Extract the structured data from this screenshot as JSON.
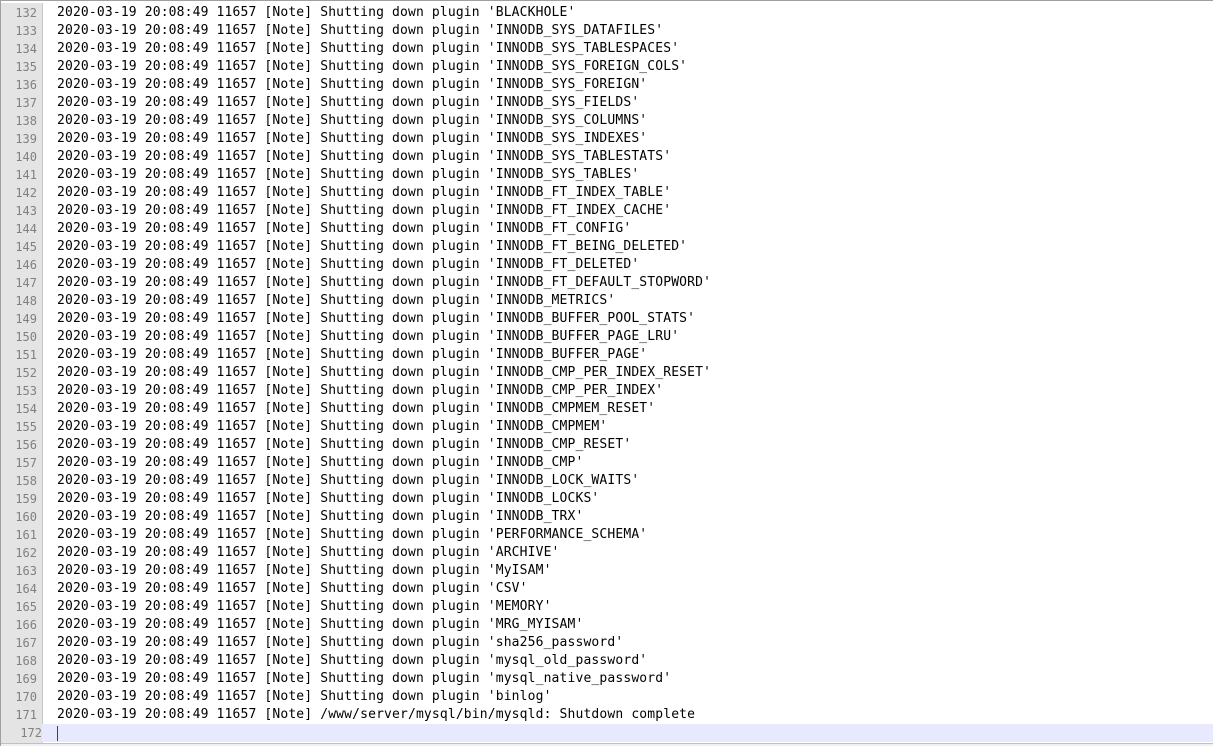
{
  "editor": {
    "current_line": 172,
    "lines": [
      {
        "num": "132",
        "text": "2020-03-19 20:08:49 11657 [Note] Shutting down plugin 'BLACKHOLE'"
      },
      {
        "num": "133",
        "text": "2020-03-19 20:08:49 11657 [Note] Shutting down plugin 'INNODB_SYS_DATAFILES'"
      },
      {
        "num": "134",
        "text": "2020-03-19 20:08:49 11657 [Note] Shutting down plugin 'INNODB_SYS_TABLESPACES'"
      },
      {
        "num": "135",
        "text": "2020-03-19 20:08:49 11657 [Note] Shutting down plugin 'INNODB_SYS_FOREIGN_COLS'"
      },
      {
        "num": "136",
        "text": "2020-03-19 20:08:49 11657 [Note] Shutting down plugin 'INNODB_SYS_FOREIGN'"
      },
      {
        "num": "137",
        "text": "2020-03-19 20:08:49 11657 [Note] Shutting down plugin 'INNODB_SYS_FIELDS'"
      },
      {
        "num": "138",
        "text": "2020-03-19 20:08:49 11657 [Note] Shutting down plugin 'INNODB_SYS_COLUMNS'"
      },
      {
        "num": "139",
        "text": "2020-03-19 20:08:49 11657 [Note] Shutting down plugin 'INNODB_SYS_INDEXES'"
      },
      {
        "num": "140",
        "text": "2020-03-19 20:08:49 11657 [Note] Shutting down plugin 'INNODB_SYS_TABLESTATS'"
      },
      {
        "num": "141",
        "text": "2020-03-19 20:08:49 11657 [Note] Shutting down plugin 'INNODB_SYS_TABLES'"
      },
      {
        "num": "142",
        "text": "2020-03-19 20:08:49 11657 [Note] Shutting down plugin 'INNODB_FT_INDEX_TABLE'"
      },
      {
        "num": "143",
        "text": "2020-03-19 20:08:49 11657 [Note] Shutting down plugin 'INNODB_FT_INDEX_CACHE'"
      },
      {
        "num": "144",
        "text": "2020-03-19 20:08:49 11657 [Note] Shutting down plugin 'INNODB_FT_CONFIG'"
      },
      {
        "num": "145",
        "text": "2020-03-19 20:08:49 11657 [Note] Shutting down plugin 'INNODB_FT_BEING_DELETED'"
      },
      {
        "num": "146",
        "text": "2020-03-19 20:08:49 11657 [Note] Shutting down plugin 'INNODB_FT_DELETED'"
      },
      {
        "num": "147",
        "text": "2020-03-19 20:08:49 11657 [Note] Shutting down plugin 'INNODB_FT_DEFAULT_STOPWORD'"
      },
      {
        "num": "148",
        "text": "2020-03-19 20:08:49 11657 [Note] Shutting down plugin 'INNODB_METRICS'"
      },
      {
        "num": "149",
        "text": "2020-03-19 20:08:49 11657 [Note] Shutting down plugin 'INNODB_BUFFER_POOL_STATS'"
      },
      {
        "num": "150",
        "text": "2020-03-19 20:08:49 11657 [Note] Shutting down plugin 'INNODB_BUFFER_PAGE_LRU'"
      },
      {
        "num": "151",
        "text": "2020-03-19 20:08:49 11657 [Note] Shutting down plugin 'INNODB_BUFFER_PAGE'"
      },
      {
        "num": "152",
        "text": "2020-03-19 20:08:49 11657 [Note] Shutting down plugin 'INNODB_CMP_PER_INDEX_RESET'"
      },
      {
        "num": "153",
        "text": "2020-03-19 20:08:49 11657 [Note] Shutting down plugin 'INNODB_CMP_PER_INDEX'"
      },
      {
        "num": "154",
        "text": "2020-03-19 20:08:49 11657 [Note] Shutting down plugin 'INNODB_CMPMEM_RESET'"
      },
      {
        "num": "155",
        "text": "2020-03-19 20:08:49 11657 [Note] Shutting down plugin 'INNODB_CMPMEM'"
      },
      {
        "num": "156",
        "text": "2020-03-19 20:08:49 11657 [Note] Shutting down plugin 'INNODB_CMP_RESET'"
      },
      {
        "num": "157",
        "text": "2020-03-19 20:08:49 11657 [Note] Shutting down plugin 'INNODB_CMP'"
      },
      {
        "num": "158",
        "text": "2020-03-19 20:08:49 11657 [Note] Shutting down plugin 'INNODB_LOCK_WAITS'"
      },
      {
        "num": "159",
        "text": "2020-03-19 20:08:49 11657 [Note] Shutting down plugin 'INNODB_LOCKS'"
      },
      {
        "num": "160",
        "text": "2020-03-19 20:08:49 11657 [Note] Shutting down plugin 'INNODB_TRX'"
      },
      {
        "num": "161",
        "text": "2020-03-19 20:08:49 11657 [Note] Shutting down plugin 'PERFORMANCE_SCHEMA'"
      },
      {
        "num": "162",
        "text": "2020-03-19 20:08:49 11657 [Note] Shutting down plugin 'ARCHIVE'"
      },
      {
        "num": "163",
        "text": "2020-03-19 20:08:49 11657 [Note] Shutting down plugin 'MyISAM'"
      },
      {
        "num": "164",
        "text": "2020-03-19 20:08:49 11657 [Note] Shutting down plugin 'CSV'"
      },
      {
        "num": "165",
        "text": "2020-03-19 20:08:49 11657 [Note] Shutting down plugin 'MEMORY'"
      },
      {
        "num": "166",
        "text": "2020-03-19 20:08:49 11657 [Note] Shutting down plugin 'MRG_MYISAM'"
      },
      {
        "num": "167",
        "text": "2020-03-19 20:08:49 11657 [Note] Shutting down plugin 'sha256_password'"
      },
      {
        "num": "168",
        "text": "2020-03-19 20:08:49 11657 [Note] Shutting down plugin 'mysql_old_password'"
      },
      {
        "num": "169",
        "text": "2020-03-19 20:08:49 11657 [Note] Shutting down plugin 'mysql_native_password'"
      },
      {
        "num": "170",
        "text": "2020-03-19 20:08:49 11657 [Note] Shutting down plugin 'binlog'"
      },
      {
        "num": "171",
        "text": "2020-03-19 20:08:49 11657 [Note] /www/server/mysql/bin/mysqld: Shutdown complete"
      },
      {
        "num": "172",
        "text": ""
      }
    ]
  }
}
